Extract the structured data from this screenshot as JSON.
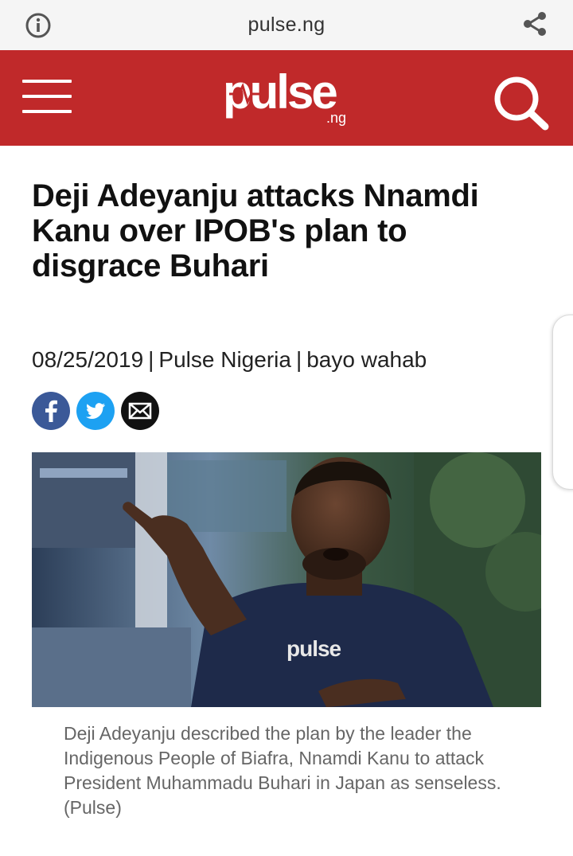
{
  "browser": {
    "url": "pulse.ng",
    "info_icon": "info-icon",
    "share_icon": "share-icon"
  },
  "header": {
    "logo_text": "pulse",
    "logo_suffix": ".ng",
    "menu_icon": "hamburger-menu-icon",
    "search_icon": "search-icon",
    "brand_color": "#c0292a"
  },
  "article": {
    "headline": "Deji Adeyanju attacks Nnamdi Kanu over IPOB's plan to disgrace Buhari",
    "date": "08/25/2019",
    "source": "Pulse Nigeria",
    "author": "bayo wahab",
    "separator": "|",
    "share": [
      {
        "icon": "facebook-icon",
        "color": "#3b5998"
      },
      {
        "icon": "twitter-icon",
        "color": "#1da1f2"
      },
      {
        "icon": "email-icon",
        "color": "#111111"
      }
    ],
    "image": {
      "watermark": "pulse"
    },
    "caption": "Deji Adeyanju described the plan by the leader the Indigenous People of Biafra, Nnamdi Kanu to attack President Muhammadu Buhari in Japan as senseless. (Pulse)"
  }
}
